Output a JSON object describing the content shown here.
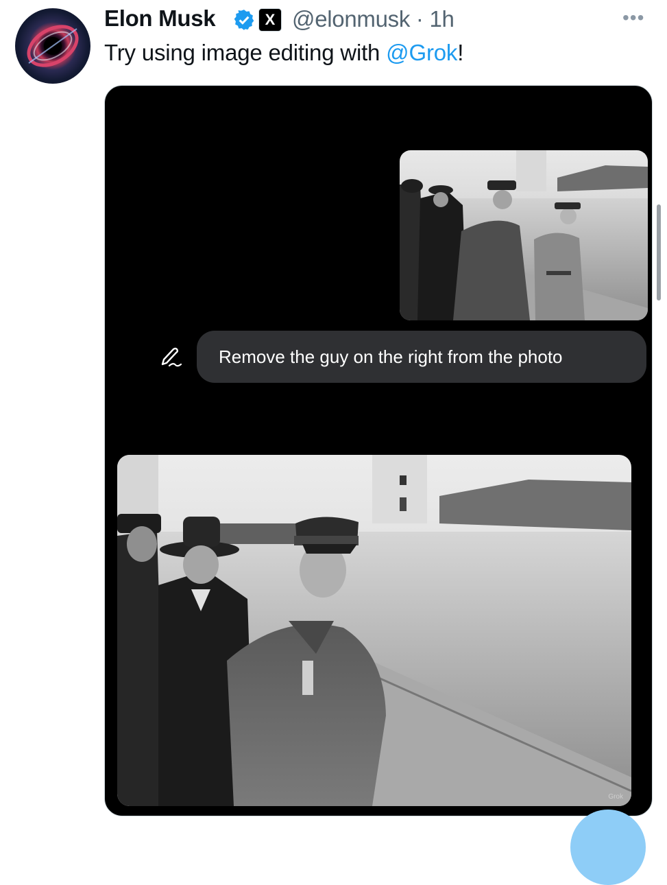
{
  "tweet": {
    "author_name": "Elon Musk",
    "handle_time": "@elonmusk · 1h",
    "text_before": "Try using image editing with ",
    "mention": "@Grok",
    "text_after": "!",
    "more": "•••"
  },
  "media": {
    "prompt": "Remove the guy on the right from the photo",
    "watermark": "Grok"
  },
  "icons": {
    "verified": "verified-badge-icon",
    "x_logo": "X",
    "edit": "edit-pen-icon",
    "more": "more-options-icon"
  },
  "colors": {
    "link": "#1d9bf0",
    "handle": "#536471",
    "media_bg": "#000000",
    "prompt_bg": "#2f3033"
  }
}
